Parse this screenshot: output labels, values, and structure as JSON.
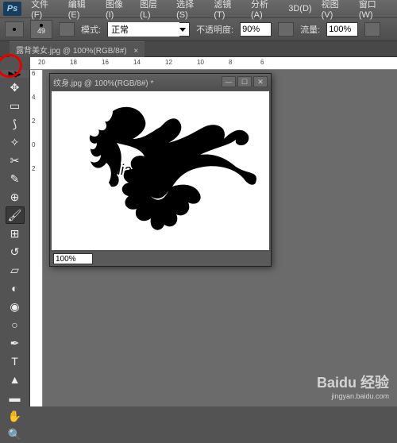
{
  "menu": {
    "items": [
      "文件(F)",
      "编辑(E)",
      "图像(I)",
      "图层(L)",
      "选择(S)",
      "滤镜(T)",
      "分析(A)",
      "3D(D)",
      "视图(V)",
      "窗口(W)"
    ]
  },
  "options": {
    "brush_size": "49",
    "mode_label": "模式:",
    "mode_value": "正常",
    "opacity_label": "不透明度:",
    "opacity_value": "90%",
    "flow_label": "流量:",
    "flow_value": "100%"
  },
  "tab": {
    "title": "露背美女.jpg @ 100%(RGB/8#)",
    "close": "×"
  },
  "ruler_h": [
    "20",
    "18",
    "16",
    "14",
    "12",
    "10",
    "8",
    "6"
  ],
  "ruler_v": [
    "6",
    "4",
    "2",
    "0",
    "2"
  ],
  "float": {
    "title": "纹身.jpg @ 100%(RGB/8#) *",
    "zoom": "100%"
  },
  "tools": [
    "move",
    "marquee",
    "lasso",
    "wand",
    "crop",
    "eyedropper",
    "heal",
    "brush",
    "stamp",
    "history",
    "eraser",
    "gradient",
    "blur",
    "dodge",
    "pen",
    "type",
    "path",
    "shape",
    "hand",
    "zoom"
  ],
  "watermark": {
    "brand": "Baidu 经验",
    "url": "jingyan.baidu.com"
  }
}
